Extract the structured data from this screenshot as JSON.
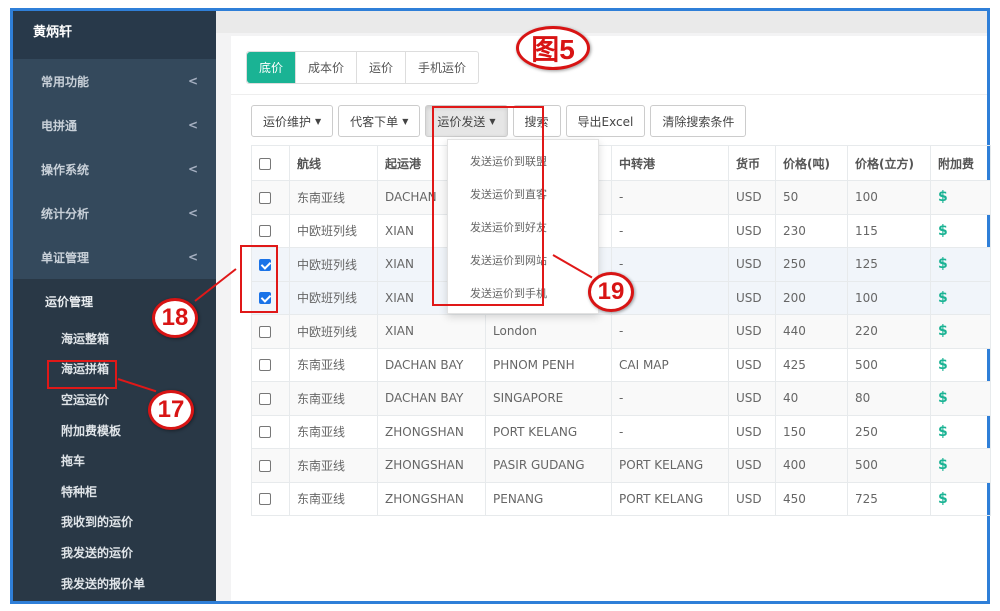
{
  "sidebar": {
    "brand": "黄炳轩",
    "items": [
      {
        "label": "常用功能"
      },
      {
        "label": "电拼通"
      },
      {
        "label": "操作系统"
      },
      {
        "label": "统计分析"
      },
      {
        "label": "单证管理"
      }
    ],
    "group": {
      "title": "运价管理",
      "items": [
        "海运整箱",
        "海运拼箱",
        "空运运价",
        "附加费模板",
        "拖车",
        "特种柜",
        "我收到的运价",
        "我发送的运价",
        "我发送的报价单"
      ]
    }
  },
  "tabs": [
    {
      "label": "底价",
      "active": true
    },
    {
      "label": "成本价"
    },
    {
      "label": "运价"
    },
    {
      "label": "手机运价"
    }
  ],
  "toolbar": {
    "maintain": "运价维护",
    "proxy": "代客下单",
    "send": "运价发送",
    "search": "搜索",
    "export": "导出Excel",
    "clear": "清除搜索条件"
  },
  "dropdown": [
    "发送运价到联盟",
    "发送运价到直客",
    "发送运价到好友",
    "发送运价到网站",
    "发送运价到手机"
  ],
  "table": {
    "headers": [
      "航线",
      "起运港",
      "",
      "中转港",
      "货币",
      "价格(吨)",
      "价格(立方)",
      "附加费"
    ],
    "rows": [
      {
        "checked": false,
        "cells": [
          "东南亚线",
          "DACHAN",
          "",
          "-",
          "USD",
          "50",
          "100",
          "$"
        ]
      },
      {
        "checked": false,
        "cells": [
          "中欧班列线",
          "XIAN",
          "",
          "-",
          "USD",
          "230",
          "115",
          "$"
        ]
      },
      {
        "checked": true,
        "cells": [
          "中欧班列线",
          "XIAN",
          "",
          "-",
          "USD",
          "250",
          "125",
          "$"
        ]
      },
      {
        "checked": true,
        "cells": [
          "中欧班列线",
          "XIAN",
          "",
          "",
          "USD",
          "200",
          "100",
          "$"
        ]
      },
      {
        "checked": false,
        "cells": [
          "中欧班列线",
          "XIAN",
          "London",
          "-",
          "USD",
          "440",
          "220",
          "$"
        ]
      },
      {
        "checked": false,
        "cells": [
          "东南亚线",
          "DACHAN BAY",
          "PHNOM PENH",
          "CAI MAP",
          "USD",
          "425",
          "500",
          "$"
        ]
      },
      {
        "checked": false,
        "cells": [
          "东南亚线",
          "DACHAN BAY",
          "SINGAPORE",
          "-",
          "USD",
          "40",
          "80",
          "$"
        ]
      },
      {
        "checked": false,
        "cells": [
          "东南亚线",
          "ZHONGSHAN",
          "PORT KELANG",
          "-",
          "USD",
          "150",
          "250",
          "$"
        ]
      },
      {
        "checked": false,
        "cells": [
          "东南亚线",
          "ZHONGSHAN",
          "PASIR GUDANG",
          "PORT KELANG",
          "USD",
          "400",
          "500",
          "$"
        ]
      },
      {
        "checked": false,
        "cells": [
          "东南亚线",
          "ZHONGSHAN",
          "PENANG",
          "PORT KELANG",
          "USD",
          "450",
          "725",
          "$"
        ]
      }
    ]
  },
  "annotations": {
    "figure": "图5",
    "n17": "17",
    "n18": "18",
    "n19": "19"
  },
  "colors": {
    "sidebar": "#2f4050",
    "accent": "#1ab394",
    "annotation": "#e01818"
  }
}
